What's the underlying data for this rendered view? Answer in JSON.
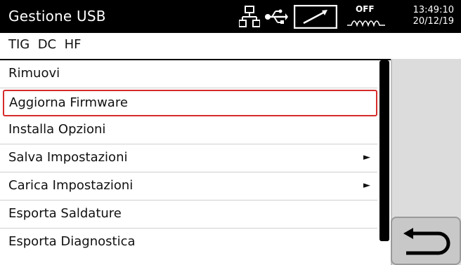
{
  "header": {
    "title": "Gestione USB",
    "status_icons": [
      "network-icon",
      "usb-icon",
      "remote-control-icon",
      "off-welding-icon"
    ],
    "off_label": "OFF",
    "time": "13:49:10",
    "date": "20/12/19"
  },
  "mode_line": "TIG  DC  HF",
  "menu": {
    "items": [
      {
        "label": "Rimuovi",
        "has_submenu": false
      },
      {
        "label": "Aggiorna Firmware",
        "has_submenu": false,
        "selected": true
      },
      {
        "label": "Installa Opzioni",
        "has_submenu": false
      },
      {
        "label": "Salva Impostazioni",
        "has_submenu": true
      },
      {
        "label": "Carica Impostazioni",
        "has_submenu": true
      },
      {
        "label": "Esporta Saldature",
        "has_submenu": false
      },
      {
        "label": "Esporta Diagnostica",
        "has_submenu": false
      }
    ],
    "submenu_arrow": "►"
  },
  "back_button": {
    "icon": "return-arrow-icon"
  },
  "colors": {
    "header_bg": "#000000",
    "selection_border": "#d62b2b",
    "panel_bg": "#dcdcdc"
  }
}
